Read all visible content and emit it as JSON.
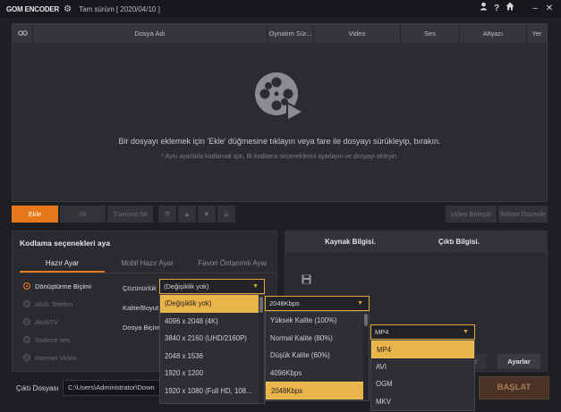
{
  "titlebar": {
    "logo": "GOM ENCODER",
    "version": "Tam sürüm   [ 2020/04/10 ]",
    "icons": [
      "gear-icon",
      "user-icon",
      "help-icon",
      "home-icon",
      "minimize-icon",
      "close-icon"
    ]
  },
  "file_list": {
    "columns": [
      "",
      "Dosya Adı",
      "Oynatım Sür...",
      "Video",
      "Ses",
      "Altyazı",
      "Yer"
    ],
    "empty_hint": "Bir dosyayı eklemek için 'Ekle' düğmesine tıklayın veya fare ile dosyayı sürükleyip, bırakın.",
    "empty_sub": "* Aynı ayarlarla kodlamak için, ilk kodlama seçeneklerini ayarlayın ve dosyayı ekleyin."
  },
  "toolbar": {
    "add": "Ekle",
    "delete": "Sil",
    "delete_all": "Tümünü Sil",
    "merge": "Video Birleştir",
    "split": "Bölüm Düzenle"
  },
  "settings": {
    "title": "Kodlama seçenekleri aya",
    "tabs": [
      "Hazır Ayar",
      "Mobil Hazır Ayar",
      "Favori Öntanımlı Ayar"
    ],
    "presets": [
      "Dönüştürme Biçimi",
      "Akıllı Telefon",
      "AkıllıTV",
      "Sadece ses",
      "Internet Video"
    ],
    "labels": {
      "resolution": "Çözünürlük",
      "quality": "Kalite/Boyut",
      "format": "Dosya Biçimi"
    }
  },
  "info": {
    "source": "Kaynak Bilgisi.",
    "output": "Çıktı Bilgisi.",
    "settings_btn": "Ayarlar",
    "partial_btn": "ar"
  },
  "resolution_dropdown": {
    "selected": "(Değişiklik yok)",
    "options": [
      "(Değişiklik yok)",
      "4096 x 2048 (4K)",
      "3840 x 2160 (UHD/2160P)",
      "2048 x 1536",
      "1920 x 1200",
      "1920 x 1080 (Full HD, 108..."
    ]
  },
  "quality_dropdown": {
    "selected": "2048Kbps",
    "options": [
      "Yüksek Kalite (100%)",
      "Normal Kalite (80%)",
      "Düşük Kalite (60%)",
      "4096Kbps",
      "2048Kbps"
    ]
  },
  "format_dropdown": {
    "selected": "MP4",
    "options": [
      "MP4",
      "AVI",
      "OGM",
      "MKV"
    ]
  },
  "bottom": {
    "output_label": "Çıktı Dosyası",
    "output_path": "C:\\Users\\Administrator\\Down",
    "start": "BAŞLAT"
  },
  "colors": {
    "accent": "#e8791b",
    "highlight": "#e9b54b",
    "background": "#1e1f23"
  }
}
